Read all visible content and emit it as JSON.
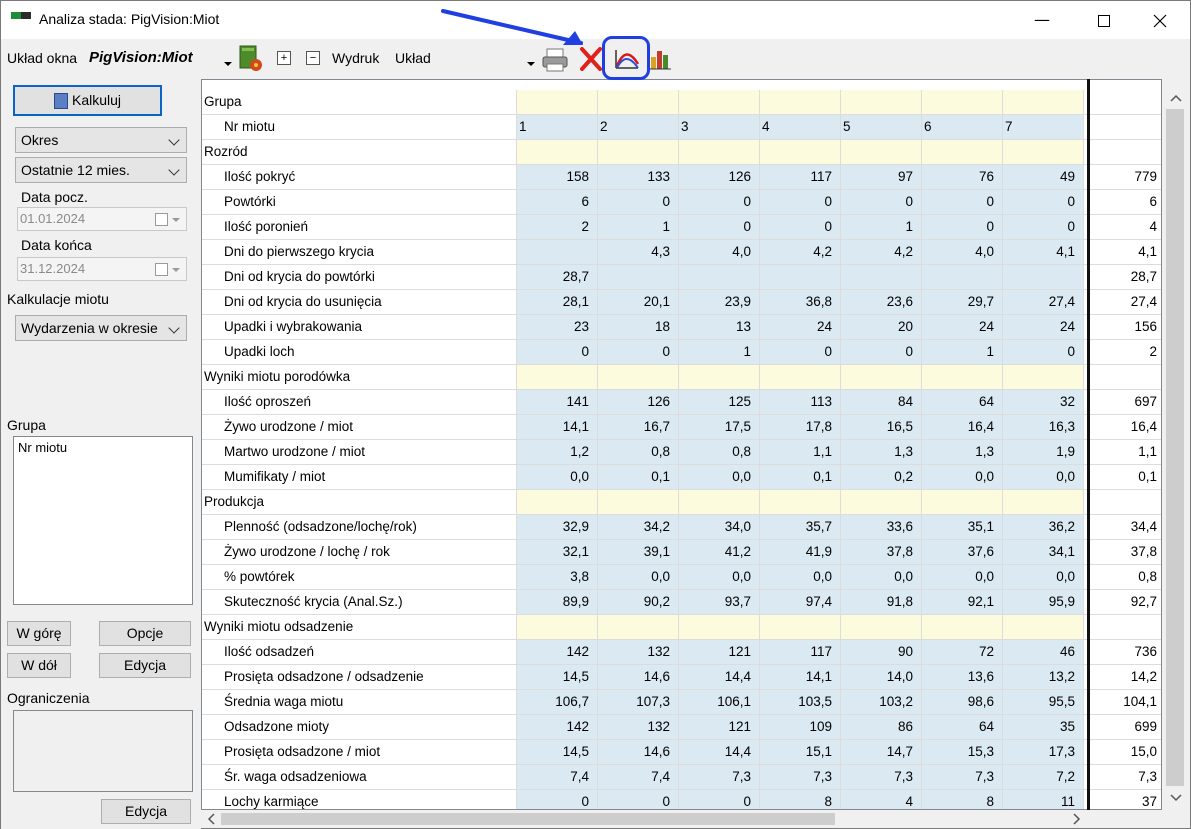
{
  "window": {
    "title": "Analiza stada: PigVision:Miot",
    "controls": [
      "minimize-button",
      "maximize-button",
      "close-button"
    ]
  },
  "toolbar": {
    "layout_label": "Układ okna",
    "layout_value": "PigVision:Miot",
    "print_label": "Wydruk",
    "print_value": "Układ",
    "plus_glyph": "+",
    "minus_glyph": "−"
  },
  "left": {
    "calculate_button": "Kalkuluj",
    "period_type": "Okres",
    "period_range": "Ostatnie 12 mies.",
    "start_date_label": "Data pocz.",
    "start_date_value": "01.01.2024",
    "end_date_label": "Data końca",
    "end_date_value": "31.12.2024",
    "calc_label": "Kalkulacje miotu",
    "calc_value": "Wydarzenia w okresie",
    "group_label": "Grupa",
    "group_items": [
      "Nr miotu"
    ],
    "up_button": "W górę",
    "options_button": "Opcje",
    "down_button": "W dół",
    "edit_button": "Edycja",
    "constraints_label": "Ograniczenia",
    "constraints_edit_button": "Edycja"
  },
  "grid": {
    "group_header": "Grupa",
    "litter_header": "Nr miotu",
    "columns": [
      "1",
      "2",
      "3",
      "4",
      "5",
      "6",
      "7"
    ],
    "rows": [
      {
        "type": "group",
        "label": "Rozród"
      },
      {
        "type": "data",
        "label": "Ilość pokryć",
        "values": [
          "158",
          "133",
          "126",
          "117",
          "97",
          "76",
          "49"
        ],
        "total": "779"
      },
      {
        "type": "data",
        "label": "Powtórki",
        "values": [
          "6",
          "0",
          "0",
          "0",
          "0",
          "0",
          "0"
        ],
        "total": "6"
      },
      {
        "type": "data",
        "label": "Ilość poronień",
        "values": [
          "2",
          "1",
          "0",
          "0",
          "1",
          "0",
          "0"
        ],
        "total": "4"
      },
      {
        "type": "data",
        "label": "Dni do pierwszego krycia",
        "values": [
          "",
          "4,3",
          "4,0",
          "4,2",
          "4,2",
          "4,0",
          "4,1"
        ],
        "total": "4,1"
      },
      {
        "type": "data",
        "label": "Dni od krycia do powtórki",
        "values": [
          "28,7",
          "",
          "",
          "",
          "",
          "",
          ""
        ],
        "total": "28,7"
      },
      {
        "type": "data",
        "label": "Dni od krycia do usunięcia",
        "values": [
          "28,1",
          "20,1",
          "23,9",
          "36,8",
          "23,6",
          "29,7",
          "27,4"
        ],
        "total": "27,4"
      },
      {
        "type": "data",
        "label": "Upadki i wybrakowania",
        "values": [
          "23",
          "18",
          "13",
          "24",
          "20",
          "24",
          "24"
        ],
        "total": "156"
      },
      {
        "type": "data",
        "label": "Upadki loch",
        "values": [
          "0",
          "0",
          "1",
          "0",
          "0",
          "1",
          "0"
        ],
        "total": "2"
      },
      {
        "type": "group",
        "label": "Wyniki miotu porodówka"
      },
      {
        "type": "data",
        "label": "Ilość oproszeń",
        "values": [
          "141",
          "126",
          "125",
          "113",
          "84",
          "64",
          "32"
        ],
        "total": "697"
      },
      {
        "type": "data",
        "label": "Żywo urodzone / miot",
        "values": [
          "14,1",
          "16,7",
          "17,5",
          "17,8",
          "16,5",
          "16,4",
          "16,3"
        ],
        "total": "16,4"
      },
      {
        "type": "data",
        "label": "Martwo urodzone / miot",
        "values": [
          "1,2",
          "0,8",
          "0,8",
          "1,1",
          "1,3",
          "1,3",
          "1,9"
        ],
        "total": "1,1"
      },
      {
        "type": "data",
        "label": "Mumifikaty / miot",
        "values": [
          "0,0",
          "0,1",
          "0,0",
          "0,1",
          "0,2",
          "0,0",
          "0,0"
        ],
        "total": "0,1"
      },
      {
        "type": "group",
        "label": "Produkcja"
      },
      {
        "type": "data",
        "label": "Plenność (odsadzone/lochę/rok)",
        "values": [
          "32,9",
          "34,2",
          "34,0",
          "35,7",
          "33,6",
          "35,1",
          "36,2"
        ],
        "total": "34,4"
      },
      {
        "type": "data",
        "label": "Żywo urodzone / lochę / rok",
        "values": [
          "32,1",
          "39,1",
          "41,2",
          "41,9",
          "37,8",
          "37,6",
          "34,1"
        ],
        "total": "37,8"
      },
      {
        "type": "data",
        "label": "% powtórek",
        "values": [
          "3,8",
          "0,0",
          "0,0",
          "0,0",
          "0,0",
          "0,0",
          "0,0"
        ],
        "total": "0,8"
      },
      {
        "type": "data",
        "label": "Skuteczność krycia (Anal.Sz.)",
        "values": [
          "89,9",
          "90,2",
          "93,7",
          "97,4",
          "91,8",
          "92,1",
          "95,9"
        ],
        "total": "92,7"
      },
      {
        "type": "group",
        "label": "Wyniki miotu odsadzenie"
      },
      {
        "type": "data",
        "label": "Ilość odsadzeń",
        "values": [
          "142",
          "132",
          "121",
          "117",
          "90",
          "72",
          "46"
        ],
        "total": "736"
      },
      {
        "type": "data",
        "label": "Prosięta odsadzone / odsadzenie",
        "values": [
          "14,5",
          "14,6",
          "14,4",
          "14,1",
          "14,0",
          "13,6",
          "13,2"
        ],
        "total": "14,2"
      },
      {
        "type": "data",
        "label": "Średnia waga miotu",
        "values": [
          "106,7",
          "107,3",
          "106,1",
          "103,5",
          "103,2",
          "98,6",
          "95,5"
        ],
        "total": "104,1"
      },
      {
        "type": "data",
        "label": "Odsadzone mioty",
        "values": [
          "142",
          "132",
          "121",
          "109",
          "86",
          "64",
          "35"
        ],
        "total": "699"
      },
      {
        "type": "data",
        "label": "Prosięta odsadzone / miot",
        "values": [
          "14,5",
          "14,6",
          "14,4",
          "15,1",
          "14,7",
          "15,3",
          "17,3"
        ],
        "total": "15,0"
      },
      {
        "type": "data",
        "label": "Śr. waga odsadzeniowa",
        "values": [
          "7,4",
          "7,4",
          "7,3",
          "7,3",
          "7,3",
          "7,3",
          "7,2"
        ],
        "total": "7,3"
      },
      {
        "type": "data",
        "label": "Lochy karmiące",
        "values": [
          "0",
          "0",
          "0",
          "8",
          "4",
          "8",
          "11"
        ],
        "total": "37"
      }
    ]
  },
  "colors": {
    "value_bg": "#dbe9f2",
    "group_bg": "#fdfbdd",
    "annotation": "#1f3fe0"
  }
}
